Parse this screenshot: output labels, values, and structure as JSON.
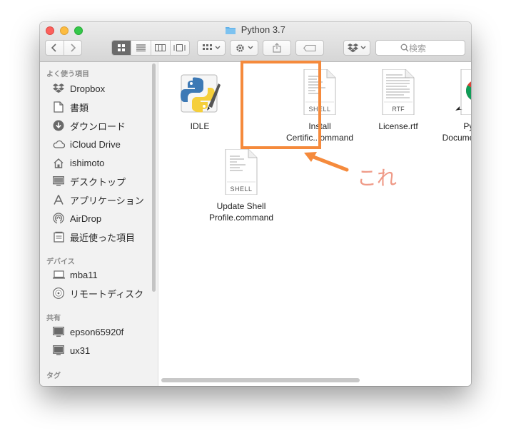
{
  "window": {
    "title": "Python 3.7"
  },
  "toolbar": {
    "search_placeholder": "検索"
  },
  "sidebar": {
    "favorites_header": "よく使う項目",
    "favorites": [
      {
        "label": "Dropbox",
        "icon": "dropbox-icon"
      },
      {
        "label": "書類",
        "icon": "documents-icon"
      },
      {
        "label": "ダウンロード",
        "icon": "download-icon"
      },
      {
        "label": "iCloud Drive",
        "icon": "cloud-icon"
      },
      {
        "label": "ishimoto",
        "icon": "home-icon"
      },
      {
        "label": "デスクトップ",
        "icon": "desktop-icon"
      },
      {
        "label": "アプリケーション",
        "icon": "applications-icon"
      },
      {
        "label": "AirDrop",
        "icon": "airdrop-icon"
      },
      {
        "label": "最近使った項目",
        "icon": "recents-icon"
      }
    ],
    "devices_header": "デバイス",
    "devices": [
      {
        "label": "mba11",
        "icon": "laptop-icon"
      },
      {
        "label": "リモートディスク",
        "icon": "disc-icon"
      }
    ],
    "shared_header": "共有",
    "shared": [
      {
        "label": "epson65920f",
        "icon": "monitor-icon"
      },
      {
        "label": "ux31",
        "icon": "monitor-icon"
      }
    ],
    "tags_header": "タグ"
  },
  "files": [
    {
      "name_line1": "IDLE",
      "name_line2": "",
      "type": "app"
    },
    {
      "name_line1": "Install",
      "name_line2": "Certific...ommand",
      "type": "shell",
      "badge": "SHELL"
    },
    {
      "name_line1": "License.rtf",
      "name_line2": "",
      "type": "rtf",
      "badge": "RTF"
    },
    {
      "name_line1": "Python",
      "name_line2": "Docume...ion.html",
      "type": "chrome"
    },
    {
      "name_line1": "Update Shell",
      "name_line2": "Profile.command",
      "type": "shell",
      "badge": "SHELL"
    }
  ],
  "annotation": {
    "text": "これ",
    "color": "#f58a3c"
  }
}
